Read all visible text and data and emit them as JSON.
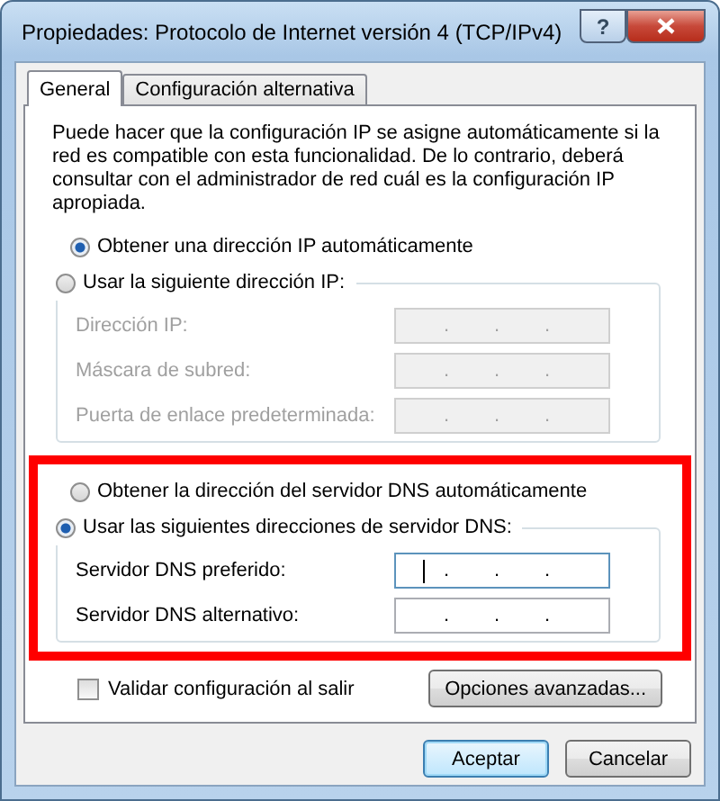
{
  "window": {
    "title": "Propiedades: Protocolo de Internet versión 4 (TCP/IPv4)",
    "buttons": [
      {
        "kind": "help",
        "label": "?"
      },
      {
        "kind": "close"
      }
    ]
  },
  "tabs": [
    {
      "label": "General",
      "selected": true
    },
    {
      "label": "Configuración alternativa",
      "selected": false
    }
  ],
  "description": "Puede hacer que la configuración IP se asigne automáticamente si la red es compatible con esta funcionalidad. De lo contrario, deberá consultar con el administrador de red cuál es la configuración IP apropiada.",
  "sections": [
    {
      "highlighted": false,
      "auto_option": {
        "label": "Obtener una dirección IP automáticamente",
        "selected": true
      },
      "manual_option": {
        "label": "Usar la siguiente dirección IP:",
        "selected": false
      },
      "fields": [
        {
          "label": "Dirección IP:",
          "disabled": true,
          "focused": false,
          "dots": [
            ".",
            ".",
            "."
          ]
        },
        {
          "label": "Máscara de subred:",
          "disabled": true,
          "focused": false,
          "dots": [
            ".",
            ".",
            "."
          ]
        },
        {
          "label": "Puerta de enlace predeterminada:",
          "disabled": true,
          "focused": false,
          "dots": [
            ".",
            ".",
            "."
          ]
        }
      ]
    },
    {
      "highlighted": true,
      "auto_option": {
        "label": "Obtener la dirección del servidor DNS automáticamente",
        "selected": false
      },
      "manual_option": {
        "label": "Usar las siguientes direcciones de servidor DNS:",
        "selected": true
      },
      "fields": [
        {
          "label": "Servidor DNS preferido:",
          "disabled": false,
          "focused": true,
          "dots": [
            ".",
            ".",
            "."
          ]
        },
        {
          "label": "Servidor DNS alternativo:",
          "disabled": false,
          "focused": false,
          "dots": [
            ".",
            ".",
            "."
          ]
        }
      ]
    }
  ],
  "validate_checkbox": {
    "label": "Validar configuración al salir",
    "checked": false
  },
  "advanced_button": "Opciones avanzadas...",
  "dialog_buttons": [
    {
      "label": "Aceptar",
      "default": true
    },
    {
      "label": "Cancelar",
      "default": false
    }
  ]
}
